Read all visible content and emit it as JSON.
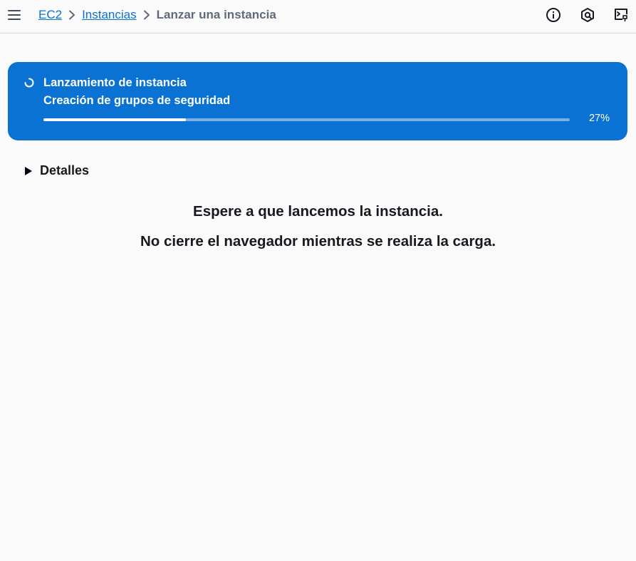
{
  "header": {
    "menu_icon": "hamburger-menu-icon",
    "breadcrumbs": [
      {
        "label": "EC2"
      },
      {
        "label": "Instancias"
      },
      {
        "label": "Lanzar una instancia"
      }
    ],
    "separator_icon": "chevron-right-icon",
    "right_icons": [
      "info-icon",
      "notifications-icon",
      "cloudshell-icon"
    ]
  },
  "flash": {
    "title": "Lanzamiento de instancia",
    "subtitle": "Creación de grupos de seguridad",
    "progress_percent": 27,
    "progress_label": "27%",
    "status_icon": "loading-spinner-icon",
    "color": "#0972d3"
  },
  "details": {
    "label": "Detalles",
    "expanded": false
  },
  "messages": {
    "line1": "Espere a que lancemos la instancia.",
    "line2": "No cierre el navegador mientras se realiza la carga."
  },
  "colors": {
    "link": "#0972d3",
    "background": "#fafafa",
    "text": "#16191f"
  }
}
